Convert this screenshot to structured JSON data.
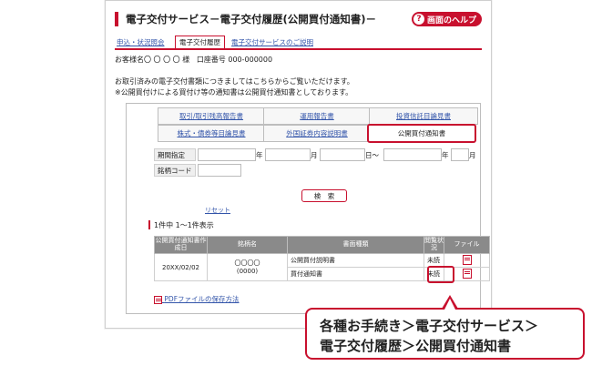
{
  "header": {
    "title": "電子交付サービス－電子交付履歴(公開買付通知書)－",
    "help_label": "画面のヘルプ",
    "help_icon": "?"
  },
  "subtabs": [
    "申込・状況照会",
    "電子交付履歴",
    "電子交付サービスのご説明"
  ],
  "customer": {
    "label": "お客様名",
    "name": "〇 〇 〇 〇",
    "suffix": "様",
    "account_label": "口座番号",
    "account_number": "000-000000"
  },
  "notices": [
    "お取引済みの電子交付書類につきましてはこちらからご覧いただけます。",
    "※公開買付けによる買付け等の通知書は公開買付通知書としております。"
  ],
  "doc_tabs": [
    [
      "取引/取引残高報告書",
      "運用報告書",
      "投資信託目論見書"
    ],
    [
      "株式・債券等目論見書",
      "外国証券内容説明書",
      "公開買付通知書"
    ]
  ],
  "form": {
    "period_label": "期間指定",
    "year": "年",
    "month": "月",
    "day_range": "日〜",
    "day": "日",
    "code_label": "銘柄コード",
    "search_button": "検　索",
    "reset": "リセット"
  },
  "result_count": "1件中 1〜1件表示",
  "table": {
    "headers": [
      "公開買付通知書作成日",
      "銘柄名",
      "書面種類",
      "閲覧状況",
      "ファイル"
    ],
    "date": "20XX/02/02",
    "issue_name": "〇〇〇〇",
    "issue_code": "(0000)",
    "rows": [
      {
        "type": "公開買付説明書",
        "status": "未読"
      },
      {
        "type": "買付通知書",
        "status": "未読"
      }
    ]
  },
  "pdf_link": "PDFファイルの保存方法",
  "callout": {
    "line1": "各種お手続き＞電子交付サービス＞",
    "line2": "電子交付履歴＞公開買付通知書"
  },
  "colors": {
    "accent": "#c8102e",
    "link": "#3355aa",
    "table_header": "#8a8a8a"
  }
}
